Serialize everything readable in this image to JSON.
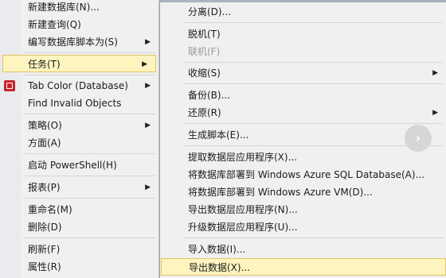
{
  "left_menu": {
    "items": [
      {
        "label": "新建数据库(N)...",
        "submenu": false
      },
      {
        "label": "新建查询(Q)",
        "submenu": false
      },
      {
        "label": "编写数据库脚本为(S)",
        "submenu": true
      },
      {
        "label": "任务(T)",
        "submenu": true,
        "highlighted": true
      },
      {
        "label": "Tab Color (Database)",
        "submenu": true
      },
      {
        "label": "Find Invalid Objects",
        "submenu": false
      },
      {
        "label": "策略(O)",
        "submenu": true
      },
      {
        "label": "方面(A)",
        "submenu": false
      },
      {
        "label": "启动 PowerShell(H)",
        "submenu": false
      },
      {
        "label": "报表(P)",
        "submenu": true
      },
      {
        "label": "重命名(M)",
        "submenu": false
      },
      {
        "label": "删除(D)",
        "submenu": false
      },
      {
        "label": "刷新(F)",
        "submenu": false
      },
      {
        "label": "属性(R)",
        "submenu": false
      }
    ]
  },
  "right_menu": {
    "items": [
      {
        "label": "分离(D)...",
        "submenu": false
      },
      {
        "label": "脱机(T)",
        "submenu": false
      },
      {
        "label": "联机(F)",
        "submenu": false,
        "disabled": true
      },
      {
        "label": "收缩(S)",
        "submenu": true
      },
      {
        "label": "备份(B)...",
        "submenu": false
      },
      {
        "label": "还原(R)",
        "submenu": true
      },
      {
        "label": "生成脚本(E)...",
        "submenu": false
      },
      {
        "label": "提取数据层应用程序(X)...",
        "submenu": false
      },
      {
        "label": "将数据库部署到 Windows Azure SQL Database(A)...",
        "submenu": false
      },
      {
        "label": "将数据库部署到 Windows Azure VM(D)...",
        "submenu": false
      },
      {
        "label": "导出数据层应用程序(N)...",
        "submenu": false
      },
      {
        "label": "升级数据层应用程序(U)...",
        "submenu": false
      },
      {
        "label": "导入数据(I)...",
        "submenu": false
      },
      {
        "label": "导出数据(X)...",
        "submenu": false,
        "highlighted": true
      }
    ]
  },
  "icons": {
    "submenu_arrow": "chevron-right-icon",
    "tab_color_icon": "database-color-icon",
    "scroll_button": "chevron-right-icon"
  },
  "scroll_glyph": "›",
  "colors": {
    "highlight_bg": "#fdf4bf",
    "highlight_border": "#e5c365",
    "menu_bg": "#f0f0f0",
    "disabled_text": "#9a9a9a",
    "tab_color_icon": "#c8242b"
  }
}
